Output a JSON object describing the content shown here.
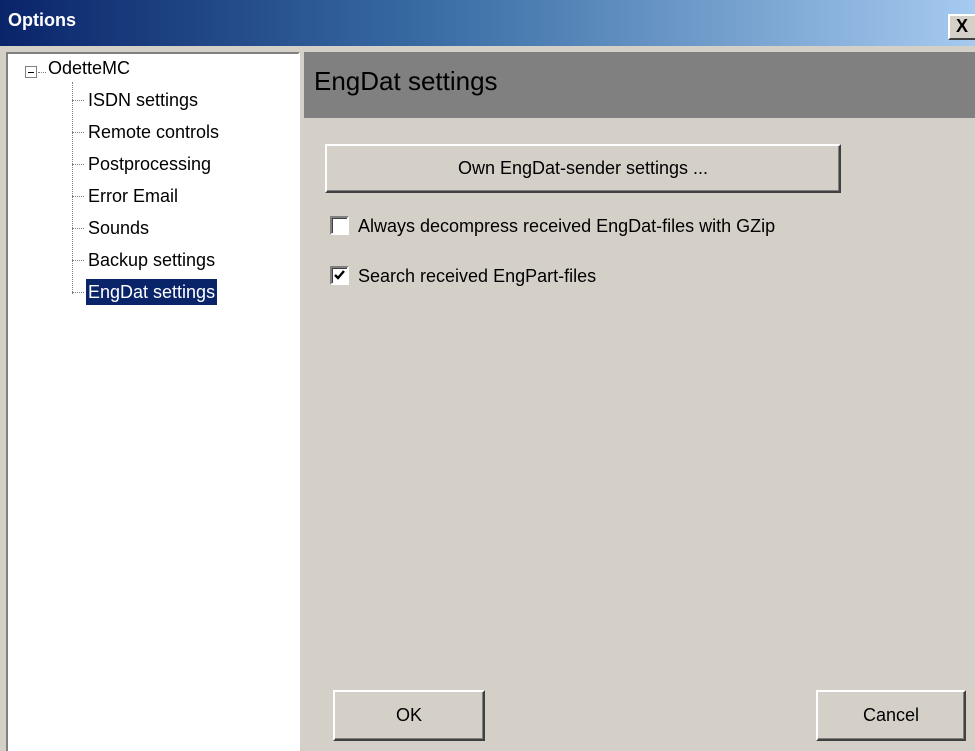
{
  "window": {
    "title": "Options",
    "close_glyph": "X"
  },
  "tree": {
    "root_label": "OdetteMC",
    "items": [
      {
        "label": "ISDN settings",
        "selected": false
      },
      {
        "label": "Remote controls",
        "selected": false
      },
      {
        "label": "Postprocessing",
        "selected": false
      },
      {
        "label": "Error Email",
        "selected": false
      },
      {
        "label": "Sounds",
        "selected": false
      },
      {
        "label": "Backup settings",
        "selected": false
      },
      {
        "label": "EngDat settings",
        "selected": true
      }
    ]
  },
  "panel": {
    "title": "EngDat settings",
    "own_button_label": "Own EngDat-sender settings ...",
    "options": [
      {
        "label": "Always decompress received EngDat-files with GZip",
        "checked": false
      },
      {
        "label": "Search received EngPart-files",
        "checked": true
      }
    ]
  },
  "footer": {
    "ok_label": "OK",
    "cancel_label": "Cancel"
  },
  "colors": {
    "face": "#d4d0c8",
    "title_start": "#0a246a",
    "title_end": "#a6caf0",
    "selection": "#0a246a",
    "header": "#808080"
  }
}
